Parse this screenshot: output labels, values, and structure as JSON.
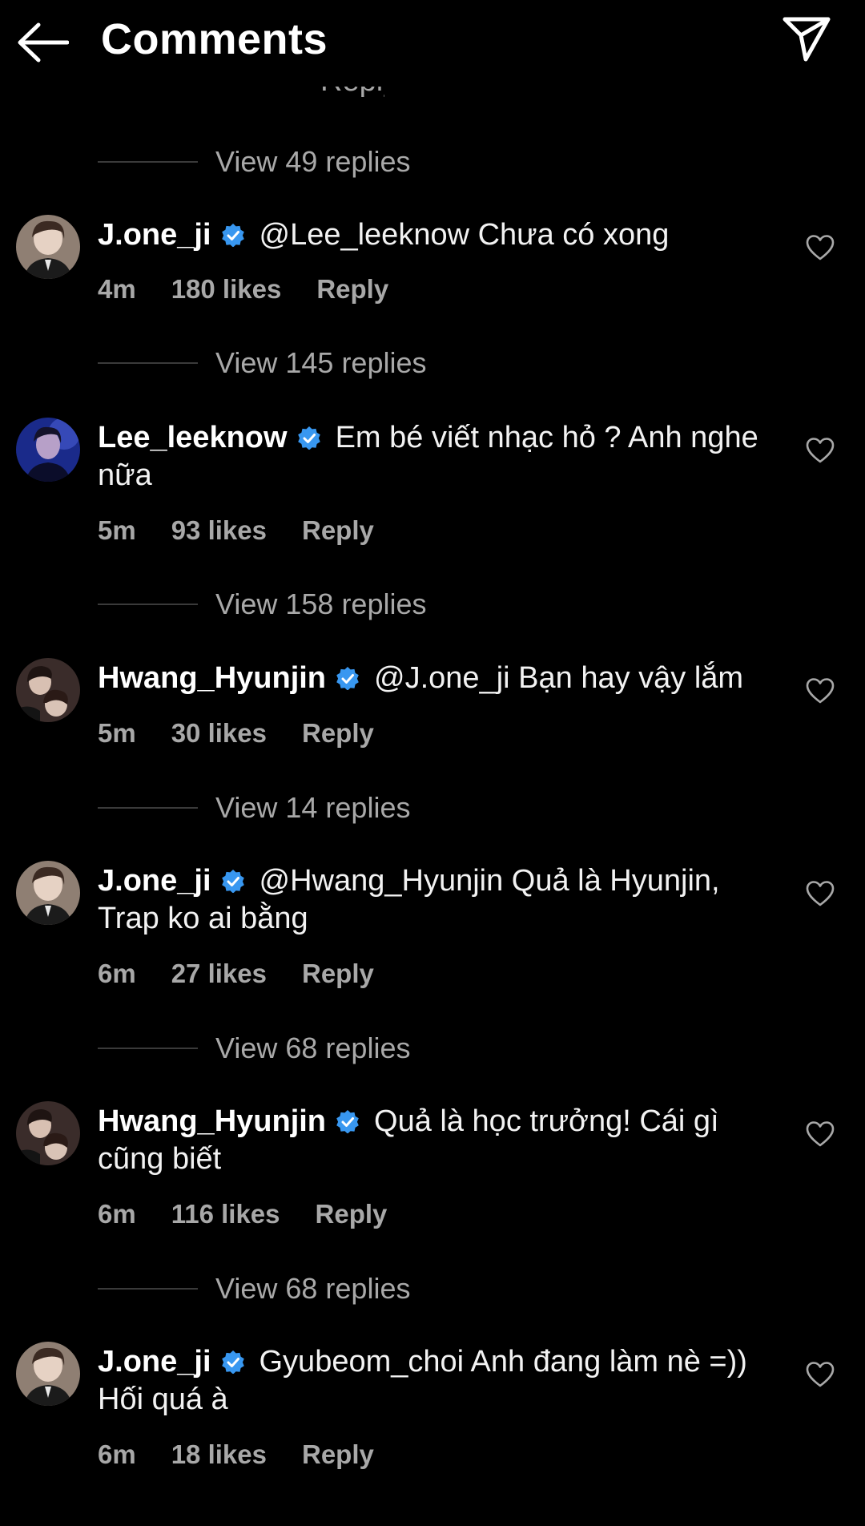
{
  "header": {
    "title": "Comments",
    "back_icon": "arrow-left-icon",
    "send_icon": "paper-plane-icon"
  },
  "partial_top_text": "Reply",
  "view_replies": [
    "View 49 replies",
    "View 145 replies",
    "View 158 replies",
    "View 14 replies",
    "View 68 replies",
    "View 68 replies"
  ],
  "comments": [
    {
      "username": "J.one_ji",
      "text": "@Lee_leeknow Chưa có xong",
      "time": "4m",
      "likes": "180 likes",
      "reply": "Reply"
    },
    {
      "username": "Lee_leeknow",
      "text": "Em bé viết nhạc hỏ ? Anh nghe nữa",
      "time": "5m",
      "likes": "93 likes",
      "reply": "Reply"
    },
    {
      "username": "Hwang_Hyunjin",
      "text": "@J.one_ji Bạn hay vậy lắm",
      "time": "5m",
      "likes": "30 likes",
      "reply": "Reply"
    },
    {
      "username": "J.one_ji",
      "text": "@Hwang_Hyunjin Quả là Hyunjin, Trap ko ai bằng",
      "time": "6m",
      "likes": "27 likes",
      "reply": "Reply"
    },
    {
      "username": "Hwang_Hyunjin",
      "text": "Quả là học trưởng! Cái gì cũng biết",
      "time": "6m",
      "likes": "116 likes",
      "reply": "Reply"
    },
    {
      "username": "J.one_ji",
      "text": "Gyubeom_choi Anh đang làm nè =)) Hối quá à",
      "time": "6m",
      "likes": "18 likes",
      "reply": "Reply"
    }
  ],
  "colors": {
    "background": "#000000",
    "text_primary": "#ffffff",
    "text_secondary": "#a8a8a8",
    "verified_blue": "#3897f0",
    "divider": "#3a3a3a"
  }
}
